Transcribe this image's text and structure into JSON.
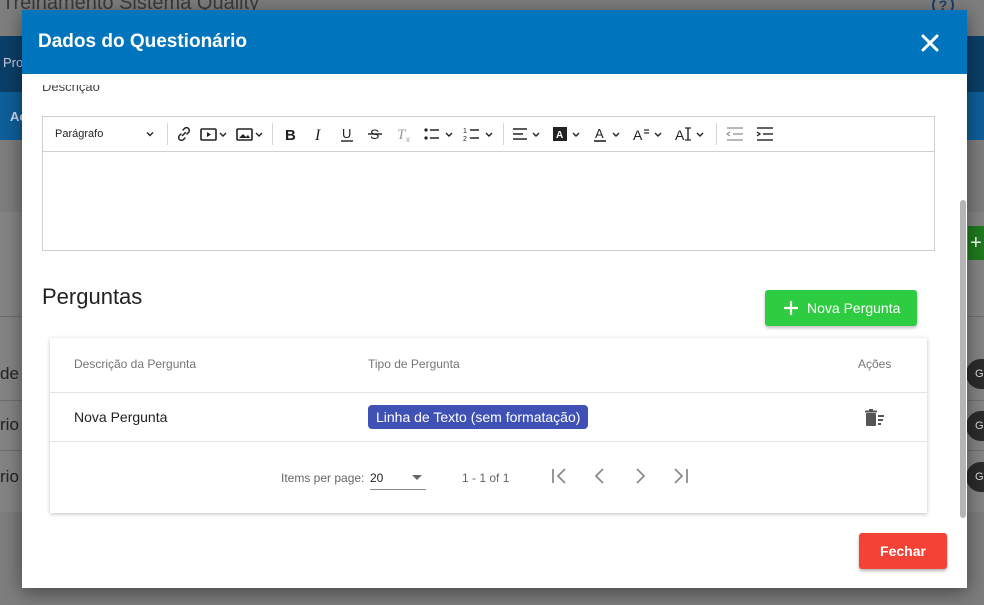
{
  "background": {
    "title": "Treinamento Sistema Quality",
    "nav_item": "Pro",
    "subnav_item": "Ac",
    "row_texts": [
      "de",
      "rio",
      "rio"
    ],
    "chip_text": "G",
    "add_symbol": "+",
    "help_symbol": "?"
  },
  "dialog": {
    "title": "Dados do Questionário",
    "close_icon": "close-icon",
    "description_label": "Descrição",
    "editor": {
      "paragraph_select": "Parágrafo",
      "buttons": [
        "link-icon",
        "video-icon",
        "image-icon",
        "bold-icon",
        "italic-icon",
        "underline-icon",
        "strikethrough-icon",
        "clear-format-icon",
        "bullet-list-icon",
        "numbered-list-icon",
        "align-icon",
        "highlight-color-icon",
        "font-color-icon",
        "font-size-icon",
        "text-case-icon",
        "outdent-icon",
        "indent-icon"
      ]
    },
    "questions": {
      "section_title": "Perguntas",
      "add_button": "Nova Pergunta",
      "columns": {
        "description": "Descrição da Pergunta",
        "type": "Tipo de Pergunta",
        "actions": "Ações"
      },
      "rows": [
        {
          "description": "Nova Pergunta",
          "type": "Linha de Texto (sem formatação)"
        }
      ],
      "pagination": {
        "items_per_page_label": "Items per page:",
        "items_per_page_value": "20",
        "range": "1 - 1 of 1"
      }
    },
    "close_button": "Fechar"
  },
  "colors": {
    "header": "#0075be",
    "add_button": "#2ecc40",
    "chip": "#3f51b5",
    "close_button": "#f44336"
  }
}
